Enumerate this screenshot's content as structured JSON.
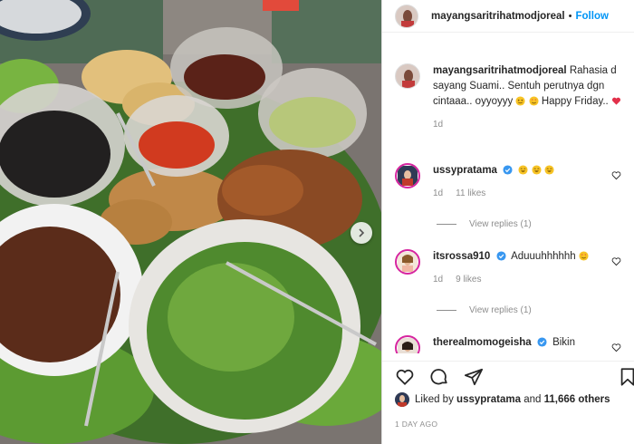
{
  "post": {
    "username": "mayangsaritrihatmodjoreal",
    "follow_label": "Follow",
    "separator": "•"
  },
  "caption": {
    "username": "mayangsaritrihatmodjoreal",
    "text": "Rahasia d sayang Suami.. Sentuh perutnya dgn cintaaa.. oyyoyyy",
    "text_end": "Happy Friday..",
    "time": "1d"
  },
  "comments": [
    {
      "username": "ussypratama",
      "text": "",
      "time": "1d",
      "likes": "11 likes",
      "replies": "View replies (1)"
    },
    {
      "username": "itsrossa910",
      "text": "Aduuuhhhhhh",
      "time": "1d",
      "likes": "9 likes",
      "replies": "View replies (1)"
    },
    {
      "username": "therealmomogeisha",
      "text": "Bikin"
    }
  ],
  "likes": {
    "prefix": "Liked by",
    "user": "ussypratama",
    "and": "and",
    "count": "11,666 others"
  },
  "time_ago": "1 DAY AGO",
  "colors": {
    "accent": "#0095f6",
    "verified": "#3897f0",
    "text": "#262626",
    "muted": "#8e8e8e"
  },
  "icons": [
    "heart-icon",
    "comment-icon",
    "share-icon",
    "bookmark-icon",
    "verified-icon",
    "next-arrow-icon"
  ]
}
